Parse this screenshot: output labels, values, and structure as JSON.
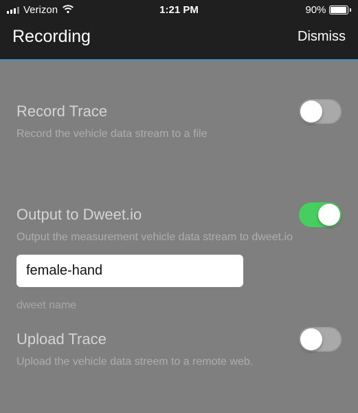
{
  "statusbar": {
    "carrier": "Verizon",
    "time": "1:21 PM",
    "battery_percent": "90%"
  },
  "navbar": {
    "title": "Recording",
    "dismiss": "Dismiss"
  },
  "record_trace": {
    "title": "Record Trace",
    "subtitle": "Record the vehicle data stream to a file",
    "enabled": false
  },
  "output_dweet": {
    "title": "Output to Dweet.io",
    "subtitle": "Output the measurement vehicle data stream to dweet.io",
    "enabled": true,
    "value": "female-hand",
    "caption": "dweet name"
  },
  "upload_trace": {
    "title": "Upload Trace",
    "subtitle": "Upload the vehicle data streem to a remote web.",
    "enabled": false
  }
}
